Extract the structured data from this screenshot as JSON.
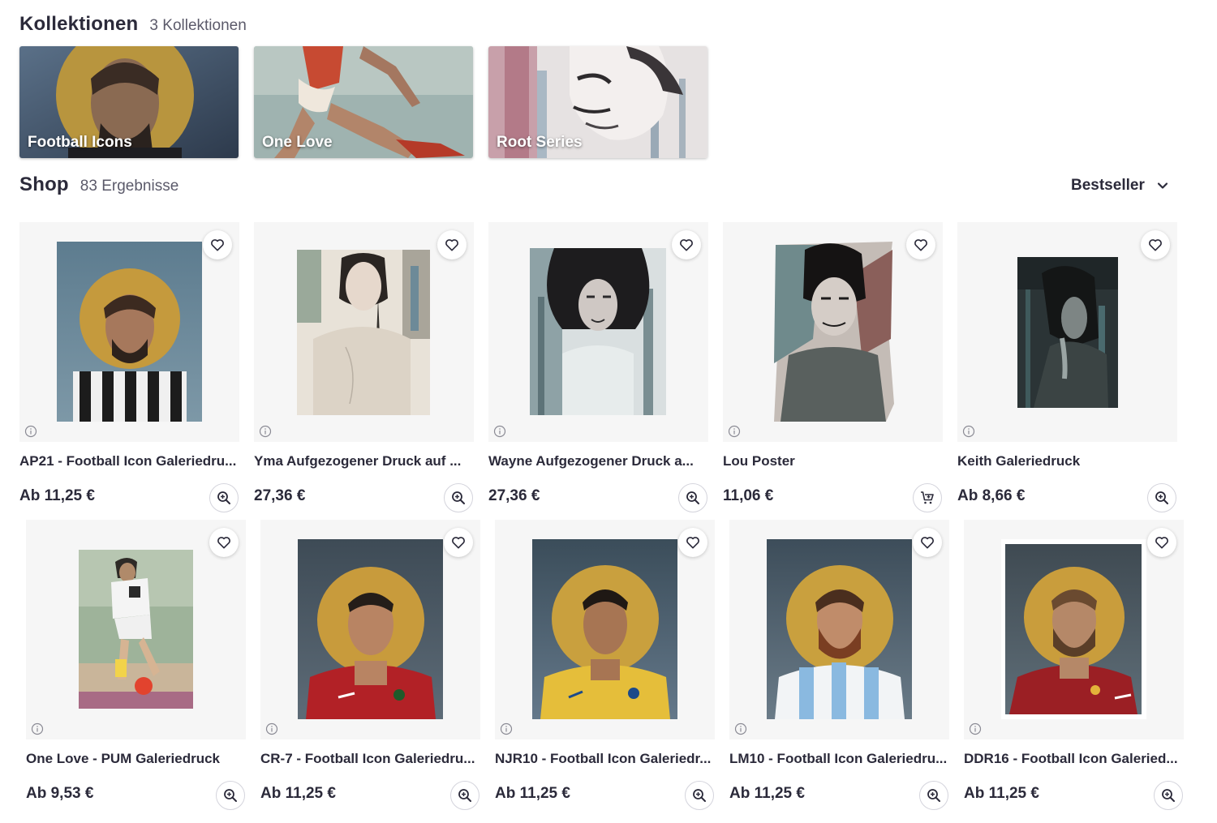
{
  "collections_header": {
    "title": "Kollektionen",
    "count": "3 Kollektionen"
  },
  "collections": [
    {
      "label": "Football Icons"
    },
    {
      "label": "One Love"
    },
    {
      "label": "Root Series"
    }
  ],
  "shop_header": {
    "title": "Shop",
    "count": "83 Ergebnisse"
  },
  "sort": {
    "label": "Bestseller",
    "icon": "chevron-down-icon"
  },
  "products": [
    {
      "name": "AP21 - Football Icon Galeriedru...",
      "price": "Ab 11,25 €",
      "action_icon": "zoom-in-icon"
    },
    {
      "name": "Yma Aufgezogener Druck auf ...",
      "price": "27,36 €",
      "action_icon": "zoom-in-icon"
    },
    {
      "name": "Wayne Aufgezogener Druck a...",
      "price": "27,36 €",
      "action_icon": "zoom-in-icon"
    },
    {
      "name": "Lou Poster",
      "price": "11,06 €",
      "action_icon": "add-to-cart-icon"
    },
    {
      "name": "Keith Galeriedruck",
      "price": "Ab 8,66 €",
      "action_icon": "zoom-in-icon"
    },
    {
      "name": "One Love - PUM Galeriedruck",
      "price": "Ab 9,53 €",
      "action_icon": "zoom-in-icon"
    },
    {
      "name": "CR-7 - Football Icon Galeriedru...",
      "price": "Ab 11,25 €",
      "action_icon": "zoom-in-icon"
    },
    {
      "name": "NJR10 - Football Icon Galeriedr...",
      "price": "Ab 11,25 €",
      "action_icon": "zoom-in-icon"
    },
    {
      "name": "LM10 - Football Icon Galeriedru...",
      "price": "Ab 11,25 €",
      "action_icon": "zoom-in-icon"
    },
    {
      "name": "DDR16 - Football Icon Galeried...",
      "price": "Ab 11,25 €",
      "action_icon": "zoom-in-icon"
    }
  ],
  "colors": {
    "text": "#2b2a3a",
    "muted": "#5b5a6a",
    "thumb_bg": "#f6f6f6",
    "gold_halo": "#c9a13e"
  }
}
